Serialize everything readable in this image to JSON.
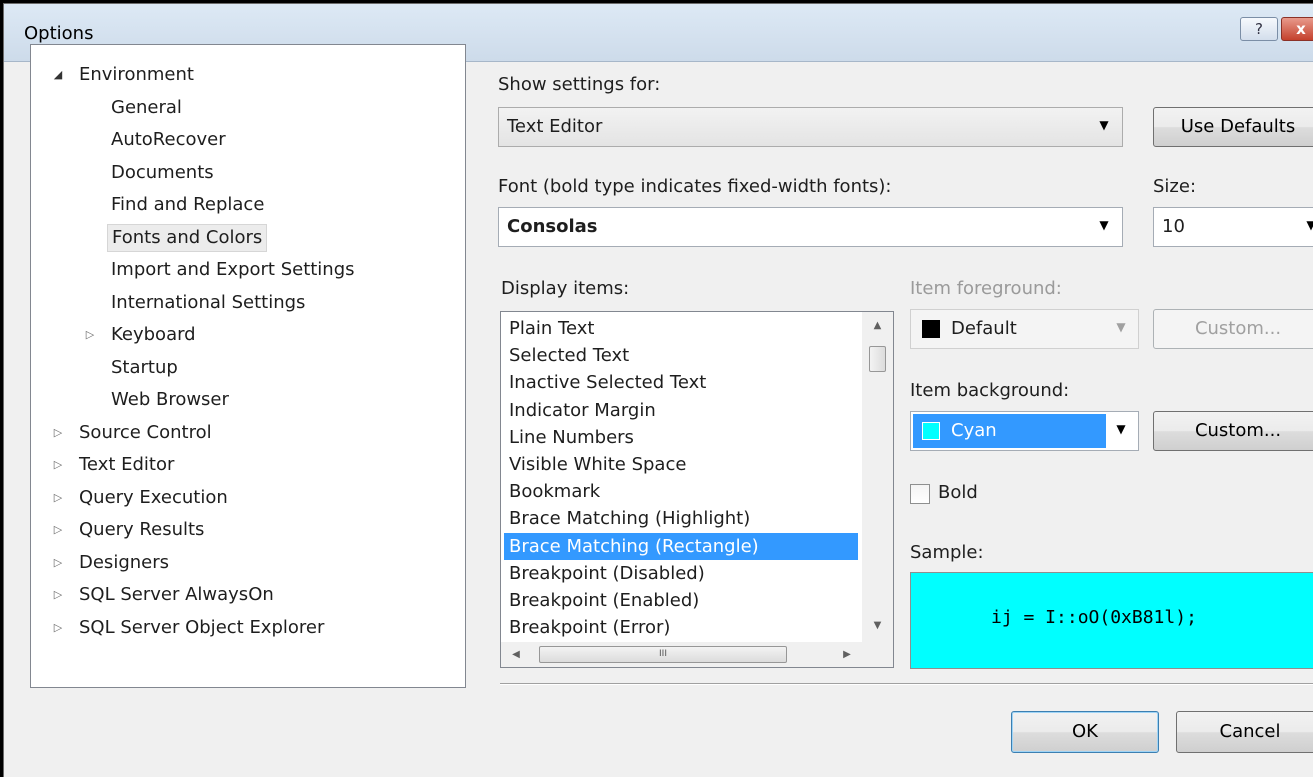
{
  "window": {
    "title": "Options",
    "help_glyph": "?",
    "close_glyph": "x"
  },
  "tree": {
    "items": [
      {
        "label": "Environment",
        "expander": "open"
      },
      {
        "label": "General"
      },
      {
        "label": "AutoRecover"
      },
      {
        "label": "Documents"
      },
      {
        "label": "Find and Replace"
      },
      {
        "label": "Fonts and Colors",
        "selected": true
      },
      {
        "label": "Import and Export Settings"
      },
      {
        "label": "International Settings"
      },
      {
        "label": "Keyboard",
        "expander": "closed"
      },
      {
        "label": "Startup"
      },
      {
        "label": "Web Browser"
      },
      {
        "label": "Source Control",
        "expander": "closed"
      },
      {
        "label": "Text Editor",
        "expander": "closed"
      },
      {
        "label": "Query Execution",
        "expander": "closed"
      },
      {
        "label": "Query Results",
        "expander": "closed"
      },
      {
        "label": "Designers",
        "expander": "closed"
      },
      {
        "label": "SQL Server AlwaysOn",
        "expander": "closed"
      },
      {
        "label": "SQL Server Object Explorer",
        "expander": "closed"
      }
    ]
  },
  "settings": {
    "show_settings_label": "Show settings for:",
    "show_settings_value": "Text Editor",
    "use_defaults_label": "Use Defaults",
    "font_label": "Font (bold type indicates fixed-width fonts):",
    "font_value": "Consolas",
    "size_label": "Size:",
    "size_value": "10"
  },
  "display_items": {
    "label": "Display items:",
    "items": [
      "Plain Text",
      "Selected Text",
      "Inactive Selected Text",
      "Indicator Margin",
      "Line Numbers",
      "Visible White Space",
      "Bookmark",
      "Brace Matching (Highlight)",
      "Brace Matching (Rectangle)",
      "Breakpoint (Disabled)",
      "Breakpoint (Enabled)",
      "Breakpoint (Error)"
    ],
    "selected": "Brace Matching (Rectangle)",
    "hscroll_thumb_glyph": "III"
  },
  "foreground": {
    "label": "Item foreground:",
    "value": "Default",
    "swatch_color": "#000000",
    "custom_label": "Custom..."
  },
  "background": {
    "label": "Item background:",
    "value": "Cyan",
    "swatch_color": "#00ffff",
    "custom_label": "Custom..."
  },
  "bold": {
    "label": "Bold",
    "checked": false
  },
  "sample": {
    "label": "Sample:",
    "text": "ij = I::oO(0xB81l);",
    "bg_color": "#00ffff"
  },
  "footer": {
    "ok_label": "OK",
    "cancel_label": "Cancel"
  },
  "colors": {
    "selection": "#3399ff",
    "dialog_bg": "#f0f0f0"
  }
}
